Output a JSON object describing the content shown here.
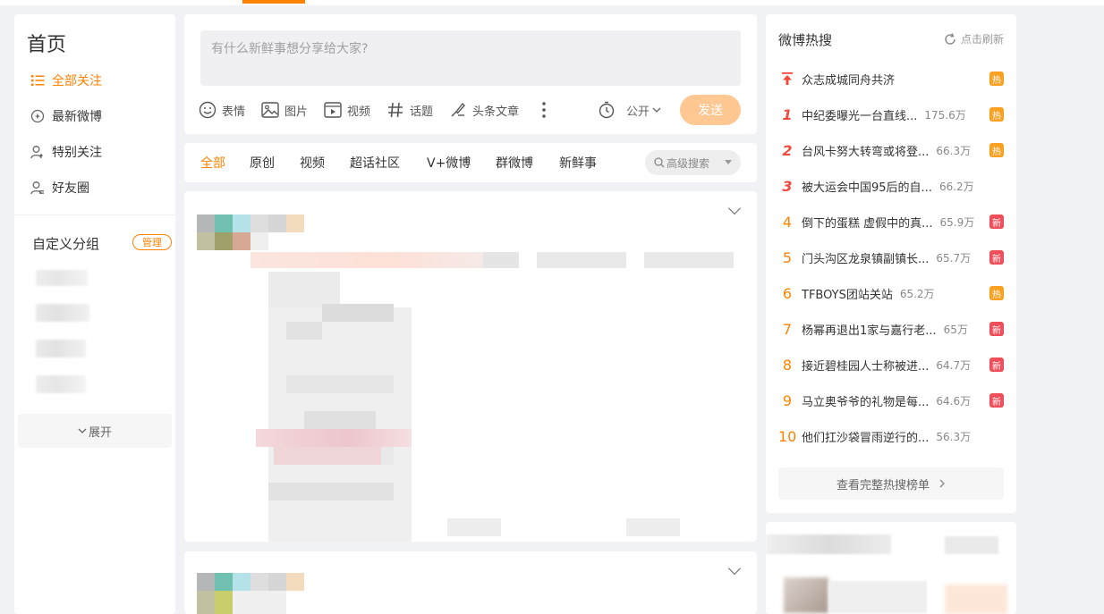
{
  "left_nav": {
    "title": "首页",
    "items": [
      {
        "label": "全部关注",
        "icon": "list-icon",
        "active": true
      },
      {
        "label": "最新微博",
        "icon": "clock-circle-icon",
        "active": false
      },
      {
        "label": "特别关注",
        "icon": "user-heart-icon",
        "active": false
      },
      {
        "label": "好友圈",
        "icon": "user-group-icon",
        "active": false
      }
    ],
    "group_title": "自定义分组",
    "manage_label": "管理",
    "expand_label": "展开"
  },
  "composer": {
    "placeholder": "有什么新鲜事想分享给大家?",
    "tools": [
      {
        "label": "表情",
        "icon": "smile-icon"
      },
      {
        "label": "图片",
        "icon": "image-icon"
      },
      {
        "label": "视频",
        "icon": "video-icon"
      },
      {
        "label": "话题",
        "icon": "hashtag-icon"
      },
      {
        "label": "头条文章",
        "icon": "article-icon"
      }
    ],
    "visibility_label": "公开",
    "post_label": "发送"
  },
  "tabs": {
    "items": [
      "全部",
      "原创",
      "视频",
      "超话社区",
      "V+微博",
      "群微博",
      "新鲜事"
    ],
    "active_index": 0,
    "advanced_search_label": "高级搜索"
  },
  "hot_search": {
    "title": "微博热搜",
    "refresh_label": "点击刷新",
    "pinned": {
      "text": "众志成城同舟共济",
      "badge": "热"
    },
    "items": [
      {
        "rank": "1",
        "text": "中纪委曝光一台直线...",
        "count": "175.6万",
        "badge": "热",
        "badge_type": "hot"
      },
      {
        "rank": "2",
        "text": "台风卡努大转弯或将登...",
        "count": "66.3万",
        "badge": "热",
        "badge_type": "hot"
      },
      {
        "rank": "3",
        "text": "被大运会中国95后的自...",
        "count": "66.2万",
        "badge": "",
        "badge_type": ""
      },
      {
        "rank": "4",
        "text": "倒下的蛋糕 虚假中的真...",
        "count": "65.9万",
        "badge": "新",
        "badge_type": "new"
      },
      {
        "rank": "5",
        "text": "门头沟区龙泉镇副镇长...",
        "count": "65.7万",
        "badge": "新",
        "badge_type": "new"
      },
      {
        "rank": "6",
        "text": "TFBOYS团站关站",
        "count": "65.2万",
        "badge": "热",
        "badge_type": "hot"
      },
      {
        "rank": "7",
        "text": "杨幂再退出1家与嘉行老...",
        "count": "65万",
        "badge": "新",
        "badge_type": "new"
      },
      {
        "rank": "8",
        "text": "接近碧桂园人士称被进...",
        "count": "64.7万",
        "badge": "新",
        "badge_type": "new"
      },
      {
        "rank": "9",
        "text": "马立奥爷爷的礼物是每...",
        "count": "64.6万",
        "badge": "新",
        "badge_type": "new"
      },
      {
        "rank": "10",
        "text": "他们扛沙袋冒雨逆行的...",
        "count": "56.3万",
        "badge": "",
        "badge_type": ""
      }
    ],
    "more_label": "查看完整热搜榜单"
  },
  "colors": {
    "accent": "#ff8200",
    "hot_badge": "#f9a123",
    "new_badge": "#f04d5b",
    "top3_rank": "#f04b3c"
  }
}
